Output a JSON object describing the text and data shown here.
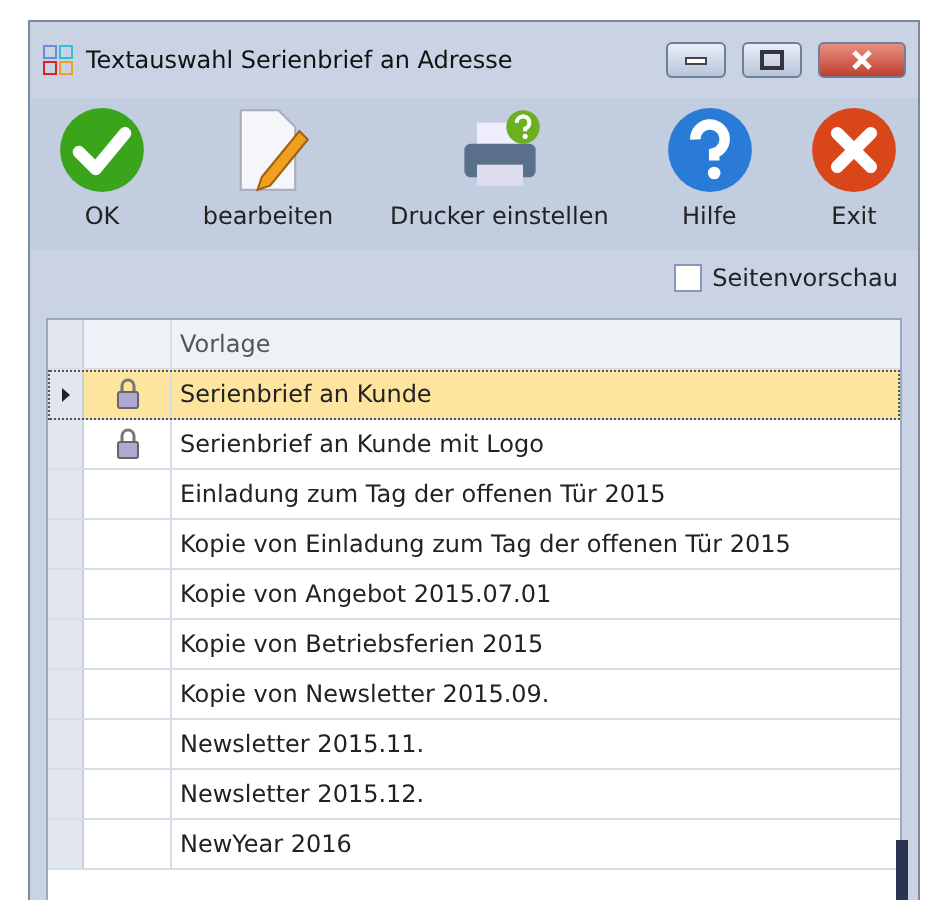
{
  "window": {
    "title": "Textauswahl Serienbrief an Adresse"
  },
  "toolbar": [
    {
      "kind": "ok",
      "label": "OK"
    },
    {
      "kind": "edit",
      "label": "bearbeiten"
    },
    {
      "kind": "printer",
      "label": "Drucker einstellen"
    },
    {
      "kind": "help",
      "label": "Hilfe"
    },
    {
      "kind": "exit",
      "label": "Exit"
    }
  ],
  "preview_checkbox": {
    "label": "Seitenvorschau",
    "checked": false
  },
  "table": {
    "columns": [
      "Vorlage"
    ],
    "rows": [
      {
        "name": "Serienbrief an Kunde",
        "locked": true,
        "selected": true
      },
      {
        "name": "Serienbrief an Kunde mit Logo",
        "locked": true,
        "selected": false
      },
      {
        "name": "Einladung zum Tag der offenen Tür 2015",
        "locked": false,
        "selected": false
      },
      {
        "name": "Kopie von Einladung zum Tag der offenen Tür 2015",
        "locked": false,
        "selected": false
      },
      {
        "name": "Kopie von Angebot 2015.07.01",
        "locked": false,
        "selected": false
      },
      {
        "name": "Kopie von Betriebsferien 2015",
        "locked": false,
        "selected": false
      },
      {
        "name": "Kopie von Newsletter 2015.09.",
        "locked": false,
        "selected": false
      },
      {
        "name": "Newsletter 2015.11.",
        "locked": false,
        "selected": false
      },
      {
        "name": "Newsletter 2015.12.",
        "locked": false,
        "selected": false
      },
      {
        "name": "NewYear 2016",
        "locked": false,
        "selected": false
      }
    ]
  }
}
